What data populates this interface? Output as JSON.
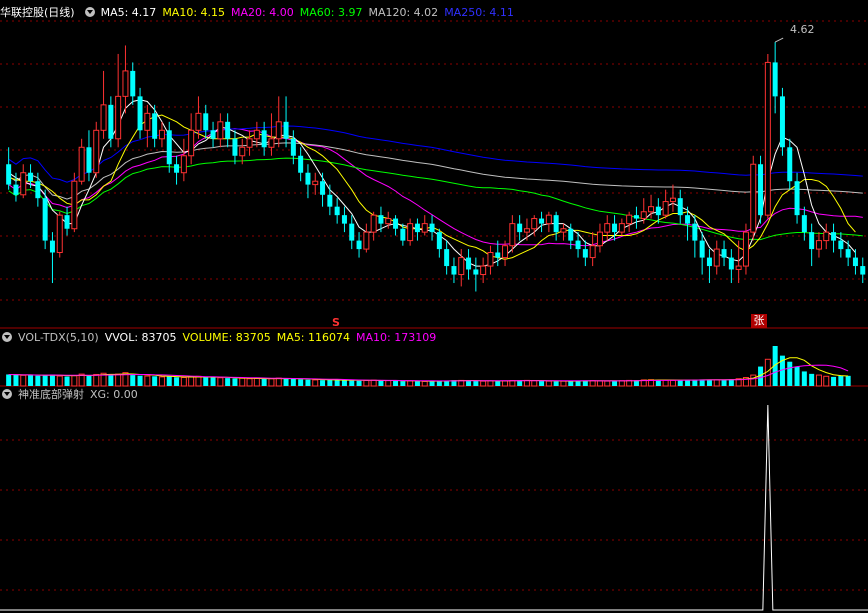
{
  "main_header": {
    "title": "华联控股(日线)",
    "ma5_label": "MA5: 4.17",
    "ma10_label": "MA10: 4.15",
    "ma20_label": "MA20: 4.00",
    "ma60_label": "MA60: 3.97",
    "ma120_label": "MA120: 4.02",
    "ma250_label": "MA250: 4.11"
  },
  "vol_header": {
    "name": "VOL-TDX(5,10)",
    "vvol_label": "VVOL: 83705",
    "volume_label": "VOLUME: 83705",
    "ma5_label": "MA5: 116074",
    "ma10_label": "MA10: 173109"
  },
  "ind_header": {
    "name": "神准底部弹射",
    "xg_label": "XG: 0.00"
  },
  "markers": {
    "s_marker": "S",
    "zhang_marker": "张",
    "high_price_label": "4.62"
  },
  "colors": {
    "up": "#ff3232",
    "down": "#00ffff",
    "ma5": "#ffffff",
    "ma10": "#ffff00",
    "ma20": "#ff00ff",
    "ma60": "#00ff00",
    "ma120": "#c0c0c0",
    "ma250": "#0000ff",
    "grid": "#8b0000"
  },
  "chart_data": [
    {
      "type": "candlestick",
      "title": "华联控股(日线)",
      "ylim": [
        3.1,
        4.75
      ],
      "candles": [
        [
          3.9,
          3.78,
          4.0,
          3.75
        ],
        [
          3.78,
          3.72,
          3.85,
          3.68
        ],
        [
          3.72,
          3.85,
          3.9,
          3.7
        ],
        [
          3.85,
          3.8,
          3.9,
          3.76
        ],
        [
          3.8,
          3.7,
          3.85,
          3.65
        ],
        [
          3.7,
          3.45,
          3.75,
          3.4
        ],
        [
          3.45,
          3.38,
          3.5,
          3.2
        ],
        [
          3.38,
          3.6,
          3.62,
          3.35
        ],
        [
          3.6,
          3.52,
          3.65,
          3.48
        ],
        [
          3.52,
          3.8,
          3.85,
          3.5
        ],
        [
          3.8,
          4.0,
          4.05,
          3.78
        ],
        [
          4.0,
          3.85,
          4.1,
          3.8
        ],
        [
          3.85,
          4.1,
          4.15,
          3.82
        ],
        [
          4.1,
          4.25,
          4.45,
          4.05
        ],
        [
          4.25,
          4.05,
          4.3,
          4.0
        ],
        [
          4.05,
          4.3,
          4.55,
          4.0
        ],
        [
          4.3,
          4.45,
          4.6,
          4.2
        ],
        [
          4.45,
          4.3,
          4.5,
          4.25
        ],
        [
          4.3,
          4.1,
          4.35,
          4.05
        ],
        [
          4.1,
          4.2,
          4.25,
          4.0
        ],
        [
          4.2,
          4.05,
          4.25,
          4.0
        ],
        [
          4.05,
          4.1,
          4.15,
          4.0
        ],
        [
          4.1,
          3.9,
          4.15,
          3.85
        ],
        [
          3.9,
          3.85,
          3.95,
          3.78
        ],
        [
          3.85,
          3.95,
          4.05,
          3.8
        ],
        [
          3.95,
          4.1,
          4.2,
          3.9
        ],
        [
          4.1,
          4.2,
          4.3,
          4.05
        ],
        [
          4.2,
          4.1,
          4.25,
          4.05
        ],
        [
          4.1,
          4.05,
          4.15,
          4.0
        ],
        [
          4.05,
          4.15,
          4.2,
          4.0
        ],
        [
          4.15,
          4.05,
          4.2,
          4.0
        ],
        [
          4.05,
          3.95,
          4.1,
          3.9
        ],
        [
          3.95,
          4.0,
          4.05,
          3.9
        ],
        [
          4.0,
          4.05,
          4.1,
          3.95
        ],
        [
          4.05,
          4.1,
          4.15,
          4.0
        ],
        [
          4.1,
          4.0,
          4.15,
          3.95
        ],
        [
          4.0,
          4.05,
          4.2,
          3.95
        ],
        [
          4.05,
          4.15,
          4.3,
          4.0
        ],
        [
          4.15,
          4.05,
          4.3,
          4.0
        ],
        [
          4.05,
          3.95,
          4.1,
          3.9
        ],
        [
          3.95,
          3.85,
          4.0,
          3.8
        ],
        [
          3.85,
          3.78,
          3.9,
          3.7
        ],
        [
          3.78,
          3.8,
          3.85,
          3.72
        ],
        [
          3.8,
          3.72,
          3.85,
          3.65
        ],
        [
          3.72,
          3.65,
          3.78,
          3.6
        ],
        [
          3.65,
          3.6,
          3.7,
          3.55
        ],
        [
          3.6,
          3.55,
          3.65,
          3.5
        ],
        [
          3.55,
          3.45,
          3.6,
          3.4
        ],
        [
          3.45,
          3.4,
          3.5,
          3.35
        ],
        [
          3.4,
          3.5,
          3.55,
          3.38
        ],
        [
          3.5,
          3.6,
          3.62,
          3.45
        ],
        [
          3.6,
          3.55,
          3.65,
          3.5
        ],
        [
          3.55,
          3.58,
          3.62,
          3.52
        ],
        [
          3.58,
          3.52,
          3.6,
          3.48
        ],
        [
          3.52,
          3.45,
          3.55,
          3.42
        ],
        [
          3.45,
          3.55,
          3.58,
          3.42
        ],
        [
          3.55,
          3.5,
          3.58,
          3.45
        ],
        [
          3.5,
          3.55,
          3.6,
          3.48
        ],
        [
          3.55,
          3.5,
          3.6,
          3.45
        ],
        [
          3.5,
          3.4,
          3.52,
          3.35
        ],
        [
          3.4,
          3.3,
          3.45,
          3.25
        ],
        [
          3.3,
          3.25,
          3.35,
          3.2
        ],
        [
          3.25,
          3.35,
          3.4,
          3.18
        ],
        [
          3.35,
          3.28,
          3.4,
          3.22
        ],
        [
          3.28,
          3.25,
          3.35,
          3.15
        ],
        [
          3.25,
          3.3,
          3.35,
          3.2
        ],
        [
          3.3,
          3.38,
          3.42,
          3.25
        ],
        [
          3.38,
          3.35,
          3.45,
          3.3
        ],
        [
          3.35,
          3.42,
          3.45,
          3.3
        ],
        [
          3.42,
          3.55,
          3.6,
          3.38
        ],
        [
          3.55,
          3.5,
          3.6,
          3.45
        ],
        [
          3.5,
          3.52,
          3.58,
          3.45
        ],
        [
          3.52,
          3.58,
          3.6,
          3.48
        ],
        [
          3.58,
          3.55,
          3.62,
          3.5
        ],
        [
          3.55,
          3.6,
          3.62,
          3.5
        ],
        [
          3.6,
          3.5,
          3.62,
          3.45
        ],
        [
          3.5,
          3.52,
          3.55,
          3.45
        ],
        [
          3.52,
          3.45,
          3.55,
          3.4
        ],
        [
          3.45,
          3.4,
          3.5,
          3.35
        ],
        [
          3.4,
          3.35,
          3.45,
          3.3
        ],
        [
          3.35,
          3.42,
          3.5,
          3.3
        ],
        [
          3.42,
          3.5,
          3.55,
          3.38
        ],
        [
          3.5,
          3.55,
          3.6,
          3.45
        ],
        [
          3.55,
          3.5,
          3.6,
          3.45
        ],
        [
          3.5,
          3.55,
          3.58,
          3.48
        ],
        [
          3.55,
          3.6,
          3.62,
          3.5
        ],
        [
          3.6,
          3.58,
          3.65,
          3.52
        ],
        [
          3.58,
          3.62,
          3.7,
          3.55
        ],
        [
          3.62,
          3.65,
          3.72,
          3.58
        ],
        [
          3.65,
          3.6,
          3.7,
          3.55
        ],
        [
          3.6,
          3.68,
          3.75,
          3.58
        ],
        [
          3.68,
          3.7,
          3.78,
          3.62
        ],
        [
          3.7,
          3.6,
          3.75,
          3.55
        ],
        [
          3.6,
          3.55,
          3.65,
          3.45
        ],
        [
          3.55,
          3.45,
          3.6,
          3.35
        ],
        [
          3.45,
          3.35,
          3.5,
          3.25
        ],
        [
          3.35,
          3.3,
          3.4,
          3.2
        ],
        [
          3.3,
          3.4,
          3.45,
          3.25
        ],
        [
          3.4,
          3.35,
          3.45,
          3.3
        ],
        [
          3.35,
          3.28,
          3.4,
          3.2
        ],
        [
          3.28,
          3.3,
          3.45,
          3.2
        ],
        [
          3.3,
          3.5,
          3.55,
          3.25
        ],
        [
          3.5,
          3.9,
          3.95,
          3.45
        ],
        [
          3.9,
          3.6,
          3.95,
          3.55
        ],
        [
          3.6,
          4.5,
          4.55,
          3.58
        ],
        [
          4.5,
          4.3,
          4.62,
          4.2
        ],
        [
          4.3,
          4.0,
          4.35,
          3.95
        ],
        [
          4.0,
          3.8,
          4.05,
          3.75
        ],
        [
          3.8,
          3.6,
          3.85,
          3.55
        ],
        [
          3.6,
          3.5,
          3.65,
          3.45
        ],
        [
          3.5,
          3.4,
          3.55,
          3.3
        ],
        [
          3.4,
          3.45,
          3.5,
          3.35
        ],
        [
          3.45,
          3.5,
          3.55,
          3.4
        ],
        [
          3.5,
          3.45,
          3.55,
          3.38
        ],
        [
          3.45,
          3.4,
          3.5,
          3.35
        ],
        [
          3.4,
          3.35,
          3.45,
          3.3
        ],
        [
          3.35,
          3.3,
          3.4,
          3.25
        ],
        [
          3.3,
          3.25,
          3.35,
          3.2
        ]
      ],
      "ma5": [
        3.85,
        3.82,
        3.8,
        3.78,
        3.77,
        3.72,
        3.63,
        3.59,
        3.55,
        3.55,
        3.66,
        3.75,
        3.85,
        4.0,
        4.05,
        4.13,
        4.23,
        4.27,
        4.28,
        4.27,
        4.22,
        4.15,
        4.07,
        4.02,
        3.97,
        3.98,
        4.02,
        4.04,
        4.08,
        4.12,
        4.11,
        4.09,
        4.07,
        4.04,
        4.03,
        4.02,
        4.04,
        4.07,
        4.07,
        4.06,
        4.02,
        3.96,
        3.89,
        3.82,
        3.75,
        3.71,
        3.66,
        3.61,
        3.53,
        3.5,
        3.5,
        3.52,
        3.54,
        3.55,
        3.54,
        3.53,
        3.52,
        3.51,
        3.51,
        3.48,
        3.45,
        3.4,
        3.36,
        3.32,
        3.3,
        3.3,
        3.31,
        3.33,
        3.36,
        3.4,
        3.44,
        3.47,
        3.5,
        3.54,
        3.55,
        3.55,
        3.55,
        3.52,
        3.49,
        3.44,
        3.42,
        3.42,
        3.45,
        3.48,
        3.52,
        3.54,
        3.56,
        3.57,
        3.61,
        3.62,
        3.65,
        3.67,
        3.65,
        3.63,
        3.58,
        3.49,
        3.41,
        3.37,
        3.36,
        3.34,
        3.33,
        3.37,
        3.47,
        3.58,
        3.8,
        3.96,
        4.06,
        4.04,
        4.0,
        3.84,
        3.66,
        3.55,
        3.5,
        3.48,
        3.46,
        3.43,
        3.38
      ],
      "ma10": [
        3.82,
        3.81,
        3.8,
        3.8,
        3.79,
        3.77,
        3.74,
        3.7,
        3.67,
        3.66,
        3.69,
        3.69,
        3.72,
        3.77,
        3.8,
        3.9,
        3.99,
        4.06,
        4.13,
        4.16,
        4.18,
        4.19,
        4.17,
        4.15,
        4.12,
        4.1,
        4.08,
        4.06,
        4.05,
        4.05,
        4.05,
        4.05,
        4.06,
        4.06,
        4.08,
        4.07,
        4.06,
        4.06,
        4.06,
        4.05,
        4.03,
        4.0,
        3.98,
        3.95,
        3.91,
        3.87,
        3.81,
        3.75,
        3.68,
        3.63,
        3.6,
        3.59,
        3.58,
        3.56,
        3.53,
        3.52,
        3.52,
        3.52,
        3.53,
        3.51,
        3.48,
        3.46,
        3.44,
        3.42,
        3.41,
        3.39,
        3.36,
        3.35,
        3.34,
        3.35,
        3.37,
        3.39,
        3.41,
        3.45,
        3.48,
        3.49,
        3.51,
        3.51,
        3.51,
        3.5,
        3.49,
        3.48,
        3.48,
        3.48,
        3.48,
        3.48,
        3.49,
        3.51,
        3.54,
        3.57,
        3.59,
        3.61,
        3.61,
        3.62,
        3.6,
        3.57,
        3.53,
        3.51,
        3.49,
        3.45,
        3.41,
        3.39,
        3.42,
        3.47,
        3.55,
        3.65,
        3.72,
        3.75,
        3.78,
        3.81,
        3.81,
        3.8,
        3.77,
        3.71,
        3.64,
        3.55,
        3.5
      ]
    },
    {
      "type": "bar",
      "title": "VOL-TDX(5,10)",
      "ylim": [
        0,
        560000
      ],
      "values": [
        95000,
        92000,
        88000,
        90000,
        85000,
        90000,
        95000,
        82000,
        78000,
        85000,
        98000,
        88000,
        95000,
        105000,
        92000,
        98000,
        110000,
        90000,
        85000,
        82000,
        80000,
        75000,
        78000,
        72000,
        70000,
        75000,
        80000,
        72000,
        70000,
        68000,
        65000,
        62000,
        64000,
        60000,
        62000,
        58000,
        60000,
        65000,
        62000,
        58000,
        55000,
        52000,
        50000,
        48000,
        50000,
        48000,
        46000,
        45000,
        44000,
        46000,
        48000,
        45000,
        44000,
        42000,
        40000,
        42000,
        40000,
        38000,
        40000,
        42000,
        45000,
        48000,
        46000,
        44000,
        42000,
        40000,
        42000,
        44000,
        42000,
        45000,
        48000,
        46000,
        44000,
        42000,
        40000,
        38000,
        40000,
        42000,
        44000,
        46000,
        44000,
        42000,
        40000,
        42000,
        44000,
        46000,
        48000,
        50000,
        52000,
        50000,
        48000,
        46000,
        48000,
        50000,
        52000,
        54000,
        52000,
        50000,
        52000,
        55000,
        60000,
        70000,
        90000,
        160000,
        220000,
        330000,
        250000,
        200000,
        160000,
        120000,
        100000,
        90000,
        80000,
        75000,
        83705,
        83705
      ]
    },
    {
      "type": "line",
      "title": "神准底部弹射",
      "ylim": [
        0,
        1
      ],
      "spike_index": 104,
      "values_note": ""
    }
  ]
}
